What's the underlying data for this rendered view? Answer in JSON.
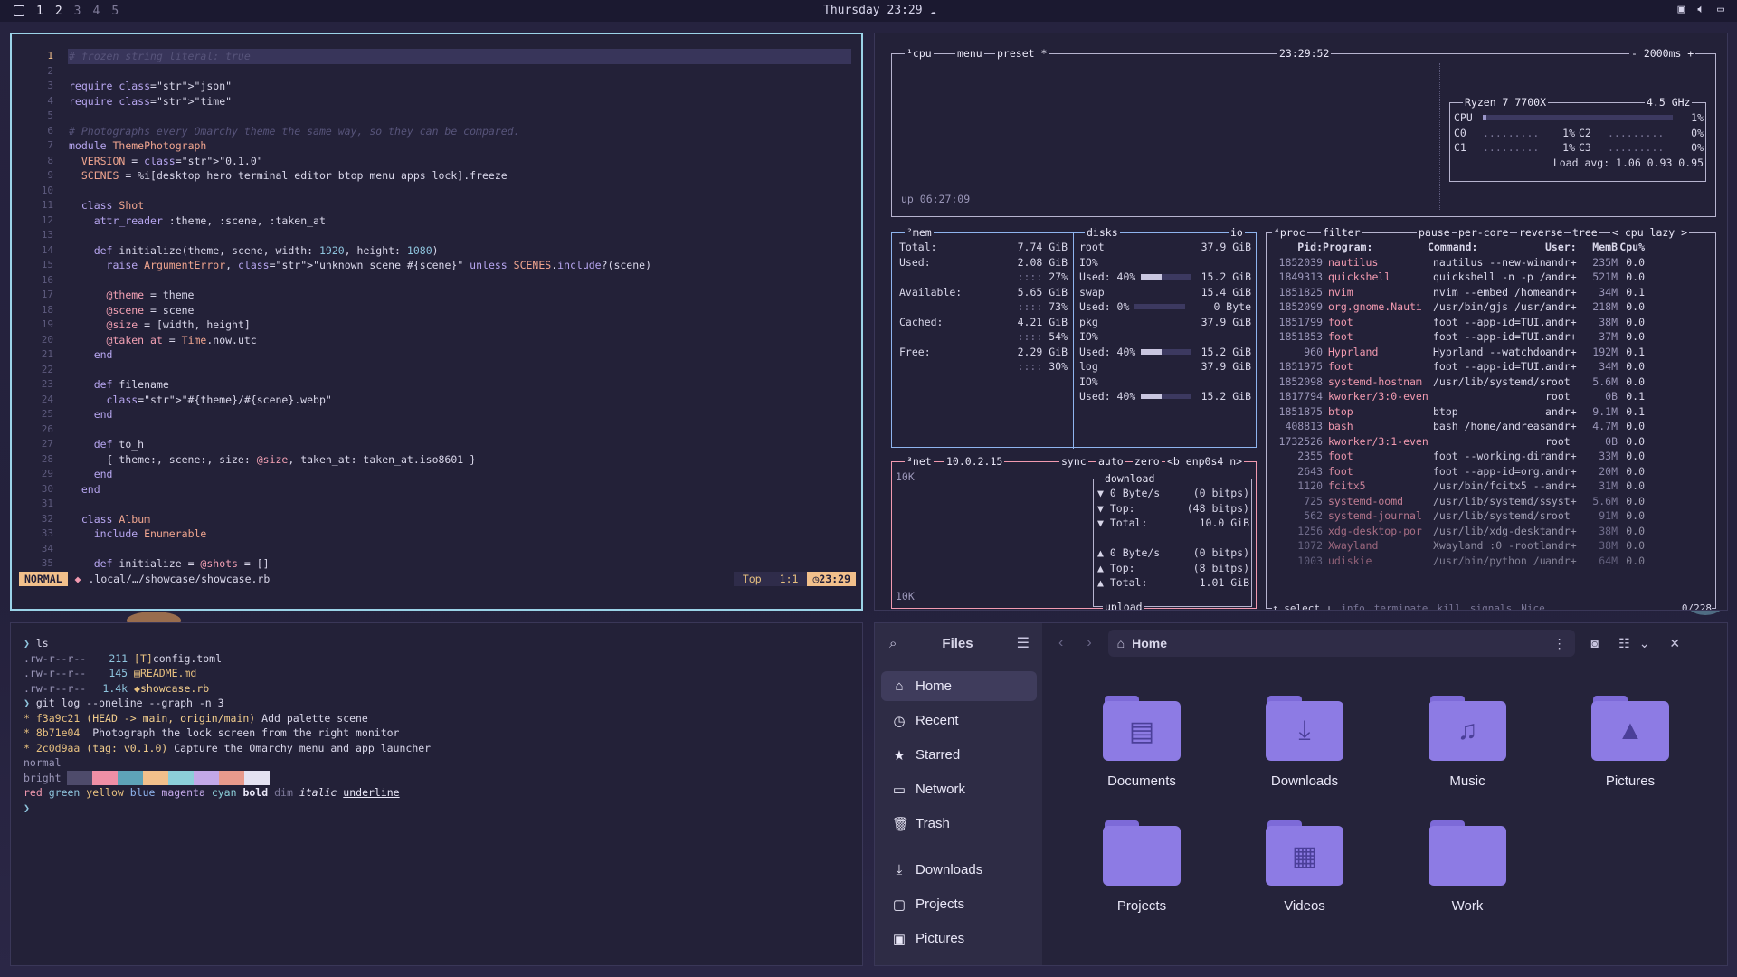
{
  "topbar": {
    "workspaces": [
      "1",
      "2",
      "3",
      "4",
      "5"
    ],
    "active_workspace": "1",
    "clock": "Thursday 23:29"
  },
  "editor": {
    "line_numbers": [
      "1",
      "2",
      "3",
      "4",
      "5",
      "6",
      "7",
      "8",
      "9",
      "10",
      "11",
      "12",
      "13",
      "14",
      "15",
      "16",
      "17",
      "18",
      "19",
      "20",
      "21",
      "22",
      "23",
      "24",
      "25",
      "26",
      "27",
      "28",
      "29",
      "30",
      "31",
      "32",
      "33",
      "34",
      "35"
    ],
    "lines": [
      "# frozen_string_literal: true",
      "",
      "require \"json\"",
      "require \"time\"",
      "",
      "# Photographs every Omarchy theme the same way, so they can be compared.",
      "module ThemePhotograph",
      "  VERSION = \"0.1.0\"",
      "  SCENES = %i[desktop hero terminal editor btop menu apps lock].freeze",
      "",
      "  class Shot",
      "    attr_reader :theme, :scene, :taken_at",
      "",
      "    def initialize(theme, scene, width: 1920, height: 1080)",
      "      raise ArgumentError, \"unknown scene #{scene}\" unless SCENES.include?(scene)",
      "",
      "      @theme = theme",
      "      @scene = scene",
      "      @size = [width, height]",
      "      @taken_at = Time.now.utc",
      "    end",
      "",
      "    def filename",
      "      \"#{theme}/#{scene}.webp\"",
      "    end",
      "",
      "    def to_h",
      "      { theme:, scene:, size: @size, taken_at: taken_at.iso8601 }",
      "    end",
      "  end",
      "",
      "  class Album",
      "    include Enumerable",
      "",
      "    def initialize = @shots = []"
    ],
    "status": {
      "mode": "NORMAL",
      "path": ".local/…/showcase/showcase.rb",
      "scroll": "Top",
      "position": "1:1",
      "time": "23:29"
    }
  },
  "btop": {
    "cpu_box": {
      "label": "¹cpu",
      "menu": "menu",
      "preset": "preset *",
      "time": "23:29:52",
      "interval": "- 2000ms +",
      "uptime": "up 06:27:09",
      "model": "Ryzen 7 7700X",
      "freq": "4.5 GHz",
      "rows": [
        {
          "name": "CPU",
          "pct": "1%"
        },
        {
          "name": "C0",
          "pct": "1%"
        },
        {
          "name": "C1",
          "pct": "1%"
        },
        {
          "name": "C2",
          "pct": "0%"
        },
        {
          "name": "C3",
          "pct": "0%"
        }
      ],
      "load": "Load avg: 1.06 0.93 0.95"
    },
    "mem": {
      "label": "²mem",
      "rows": [
        {
          "k": "Total:",
          "v": "7.74 GiB",
          "p": ""
        },
        {
          "k": "Used:",
          "v": "2.08 GiB",
          "p": "27%"
        },
        {
          "k": "Available:",
          "v": "5.65 GiB",
          "p": "73%"
        },
        {
          "k": "Cached:",
          "v": "4.21 GiB",
          "p": "54%"
        },
        {
          "k": "Free:",
          "v": "2.29 GiB",
          "p": "30%"
        }
      ]
    },
    "disks": {
      "label": "disks",
      "io": "io",
      "rows": [
        [
          "root",
          "37.9 GiB"
        ],
        [
          "IO%",
          ""
        ],
        [
          "Used: 40%",
          "15.2 GiB"
        ],
        [
          "swap",
          "15.4 GiB"
        ],
        [
          "Used:  0%",
          "0 Byte"
        ],
        [
          "pkg",
          "37.9 GiB"
        ],
        [
          "IO%",
          ""
        ],
        [
          "Used: 40%",
          "15.2 GiB"
        ],
        [
          "log",
          "37.9 GiB"
        ],
        [
          "IO%",
          ""
        ],
        [
          "Used: 40%",
          "15.2 GiB"
        ]
      ]
    },
    "net": {
      "label": "³net",
      "ip": "10.0.2.15",
      "sync": "sync",
      "auto": "auto",
      "zero": "zero",
      "iface": "<b enp0s4 n>",
      "scale": "10K",
      "download_title": "download",
      "upload_title": "upload",
      "down": [
        [
          "▼ 0 Byte/s",
          "(0 bitps)"
        ],
        [
          "▼ Top:",
          "(48 bitps)"
        ],
        [
          "▼ Total:",
          "10.0 GiB"
        ]
      ],
      "up": [
        [
          "▲ 0 Byte/s",
          "(0 bitps)"
        ],
        [
          "▲ Top:",
          "(8 bitps)"
        ],
        [
          "▲ Total:",
          "1.01 GiB"
        ]
      ]
    },
    "proc": {
      "label": "⁴proc",
      "filter": "filter",
      "pause": "pause",
      "percore": "per-core",
      "reverse": "reverse",
      "tree": "tree",
      "sort": "< cpu lazy >",
      "headers": [
        "Pid:",
        "Program:",
        "Command:",
        "User:",
        "MemB",
        "Cpu%"
      ],
      "rows": [
        [
          "1852039",
          "nautilus",
          "nautilus --new-win",
          "andr+",
          "235M",
          "0.0"
        ],
        [
          "1849313",
          "quickshell",
          "quickshell -n -p /",
          "andr+",
          "521M",
          "0.0"
        ],
        [
          "1851825",
          "nvim",
          "nvim --embed /home",
          "andr+",
          "34M",
          "0.1"
        ],
        [
          "1852099",
          "org.gnome.Nauti",
          "/usr/bin/gjs /usr/",
          "andr+",
          "218M",
          "0.0"
        ],
        [
          "1851799",
          "foot",
          "foot --app-id=TUI.",
          "andr+",
          "38M",
          "0.0"
        ],
        [
          "1851853",
          "foot",
          "foot --app-id=TUI.",
          "andr+",
          "37M",
          "0.0"
        ],
        [
          "960",
          "Hyprland",
          "Hyprland --watchdo",
          "andr+",
          "192M",
          "0.1"
        ],
        [
          "1851975",
          "foot",
          "foot --app-id=TUI.",
          "andr+",
          "34M",
          "0.0"
        ],
        [
          "1852098",
          "systemd-hostnam",
          "/usr/lib/systemd/s",
          "root",
          "5.6M",
          "0.0"
        ],
        [
          "1817794",
          "kworker/3:0-even",
          "",
          "root",
          "0B",
          "0.1"
        ],
        [
          "1851875",
          "btop",
          "btop",
          "andr+",
          "9.1M",
          "0.1"
        ],
        [
          "408813",
          "bash",
          "bash /home/andreas",
          "andr+",
          "4.7M",
          "0.0"
        ],
        [
          "1732526",
          "kworker/3:1-even",
          "",
          "root",
          "0B",
          "0.0"
        ],
        [
          "2355",
          "foot",
          "foot --working-dir",
          "andr+",
          "33M",
          "0.0"
        ],
        [
          "2643",
          "foot",
          "foot --app-id=org.",
          "andr+",
          "20M",
          "0.0"
        ],
        [
          "1120",
          "fcitx5",
          "/usr/bin/fcitx5 --",
          "andr+",
          "31M",
          "0.0"
        ],
        [
          "725",
          "systemd-oomd",
          "/usr/lib/systemd/s",
          "syst+",
          "5.6M",
          "0.0"
        ],
        [
          "562",
          "systemd-journal",
          "/usr/lib/systemd/s",
          "root",
          "91M",
          "0.0"
        ],
        [
          "1256",
          "xdg-desktop-por",
          "/usr/lib/xdg-deskt",
          "andr+",
          "38M",
          "0.0"
        ],
        [
          "1072",
          "Xwayland",
          "Xwayland :0 -rootl",
          "andr+",
          "38M",
          "0.0"
        ],
        [
          "1003",
          "udiskie",
          "/usr/bin/python /u",
          "andr+",
          "64M",
          "0.0"
        ]
      ],
      "footer": {
        "select": "↑ select ↓",
        "info": "info",
        "terminate": "terminate",
        "kill": "kill",
        "signals": "signals",
        "nice": "Nice",
        "count": "0/228"
      }
    }
  },
  "terminal": {
    "prompt": "❯",
    "cmd1": "ls",
    "ls": [
      {
        "perm": ".rw-r--r--",
        "size": "211",
        "icon": "[T]",
        "name": "config.toml"
      },
      {
        "perm": ".rw-r--r--",
        "size": "145",
        "icon": "▤",
        "name": "README.md"
      },
      {
        "perm": ".rw-r--r--",
        "size": "1.4k",
        "icon": "◆",
        "name": "showcase.rb"
      }
    ],
    "cmd2": "git log --oneline --graph -n 3",
    "log": [
      {
        "hash": "f3a9c21",
        "ref": "(HEAD -> main, origin/main)",
        "msg": "Add palette scene"
      },
      {
        "hash": "8b71e04",
        "ref": "",
        "msg": "Photograph the lock screen from the right monitor"
      },
      {
        "hash": "2c0d9aa",
        "ref": "(tag: v0.1.0)",
        "msg": "Capture the Omarchy menu and app launcher"
      }
    ],
    "normal_label": "normal",
    "bright_label": "bright",
    "palette": [
      "#4e4b6b",
      "#ef8fa6",
      "#5ea3b8",
      "#f2c08b",
      "#8ccfd9",
      "#c3a8e8",
      "#e89a8c",
      "#e4e2f2"
    ],
    "styles": [
      "red",
      "green",
      "yellow",
      "blue",
      "magenta",
      "cyan",
      "bold",
      "dim",
      "italic",
      "underline"
    ]
  },
  "files": {
    "title": "Files",
    "location": "Home",
    "places": [
      "Home",
      "Recent",
      "Starred",
      "Network",
      "Trash"
    ],
    "bookmarks": [
      "Downloads",
      "Projects",
      "Pictures"
    ],
    "folders": [
      {
        "name": "Documents",
        "glyph": "▤"
      },
      {
        "name": "Downloads",
        "glyph": "⤓"
      },
      {
        "name": "Music",
        "glyph": "♫"
      },
      {
        "name": "Pictures",
        "glyph": "▲"
      },
      {
        "name": "Projects",
        "glyph": ""
      },
      {
        "name": "Videos",
        "glyph": "▦"
      },
      {
        "name": "Work",
        "glyph": ""
      }
    ]
  },
  "colors": {
    "accent": "#9bd3e8",
    "pink": "#f29ab0",
    "folder": "#8d7be4",
    "bg": "#232138"
  }
}
